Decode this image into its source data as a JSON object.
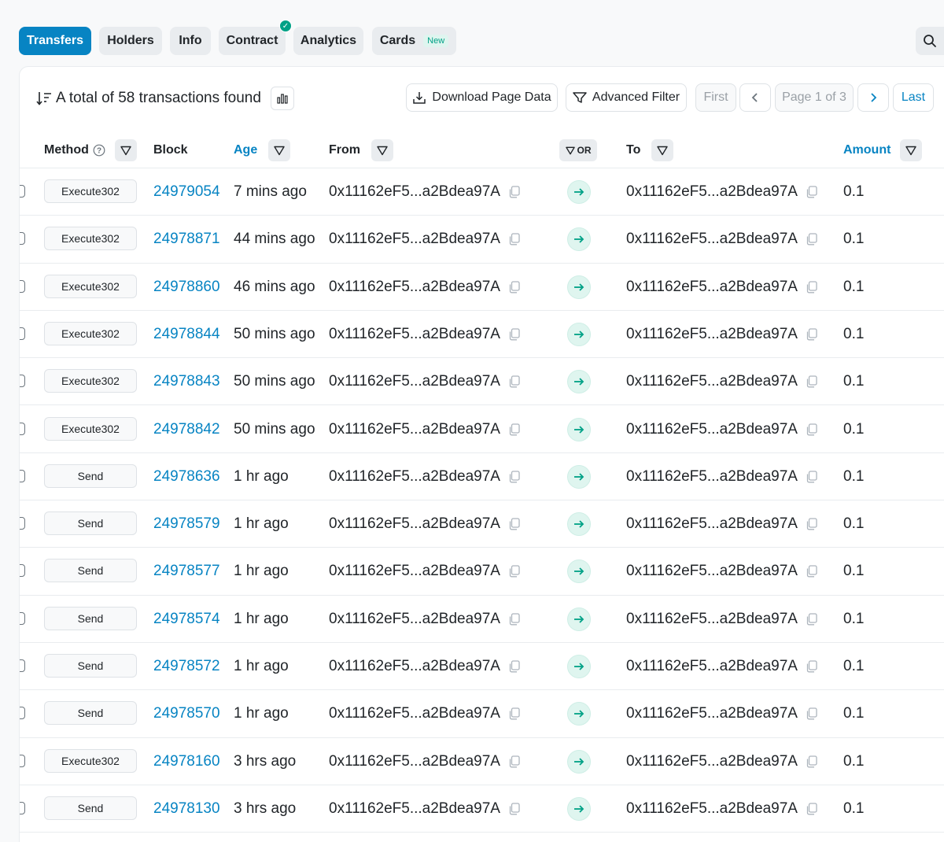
{
  "tabs": [
    {
      "label": "Transfers",
      "active": true
    },
    {
      "label": "Holders"
    },
    {
      "label": "Info"
    },
    {
      "label": "Contract",
      "verified": true
    },
    {
      "label": "Analytics"
    },
    {
      "label": "Cards",
      "badge": "New"
    }
  ],
  "toolbar": {
    "summary": "A total of 58 transactions found",
    "download_label": "Download Page Data",
    "filter_label": "Advanced Filter",
    "first_label": "First",
    "page_label": "Page 1 of 3",
    "last_label": "Last"
  },
  "table": {
    "headers": {
      "method": "Method",
      "block": "Block",
      "age": "Age",
      "from": "From",
      "or": "OR",
      "to": "To",
      "amount": "Amount"
    },
    "rows": [
      {
        "method": "Execute302",
        "block": "24979054",
        "age": "7 mins ago",
        "from": "0x11162eF5...a2Bdea97A",
        "to": "0x11162eF5...a2Bdea97A",
        "amount": "0.1"
      },
      {
        "method": "Execute302",
        "block": "24978871",
        "age": "44 mins ago",
        "from": "0x11162eF5...a2Bdea97A",
        "to": "0x11162eF5...a2Bdea97A",
        "amount": "0.1"
      },
      {
        "method": "Execute302",
        "block": "24978860",
        "age": "46 mins ago",
        "from": "0x11162eF5...a2Bdea97A",
        "to": "0x11162eF5...a2Bdea97A",
        "amount": "0.1"
      },
      {
        "method": "Execute302",
        "block": "24978844",
        "age": "50 mins ago",
        "from": "0x11162eF5...a2Bdea97A",
        "to": "0x11162eF5...a2Bdea97A",
        "amount": "0.1"
      },
      {
        "method": "Execute302",
        "block": "24978843",
        "age": "50 mins ago",
        "from": "0x11162eF5...a2Bdea97A",
        "to": "0x11162eF5...a2Bdea97A",
        "amount": "0.1"
      },
      {
        "method": "Execute302",
        "block": "24978842",
        "age": "50 mins ago",
        "from": "0x11162eF5...a2Bdea97A",
        "to": "0x11162eF5...a2Bdea97A",
        "amount": "0.1"
      },
      {
        "method": "Send",
        "block": "24978636",
        "age": "1 hr ago",
        "from": "0x11162eF5...a2Bdea97A",
        "to": "0x11162eF5...a2Bdea97A",
        "amount": "0.1"
      },
      {
        "method": "Send",
        "block": "24978579",
        "age": "1 hr ago",
        "from": "0x11162eF5...a2Bdea97A",
        "to": "0x11162eF5...a2Bdea97A",
        "amount": "0.1"
      },
      {
        "method": "Send",
        "block": "24978577",
        "age": "1 hr ago",
        "from": "0x11162eF5...a2Bdea97A",
        "to": "0x11162eF5...a2Bdea97A",
        "amount": "0.1"
      },
      {
        "method": "Send",
        "block": "24978574",
        "age": "1 hr ago",
        "from": "0x11162eF5...a2Bdea97A",
        "to": "0x11162eF5...a2Bdea97A",
        "amount": "0.1"
      },
      {
        "method": "Send",
        "block": "24978572",
        "age": "1 hr ago",
        "from": "0x11162eF5...a2Bdea97A",
        "to": "0x11162eF5...a2Bdea97A",
        "amount": "0.1"
      },
      {
        "method": "Send",
        "block": "24978570",
        "age": "1 hr ago",
        "from": "0x11162eF5...a2Bdea97A",
        "to": "0x11162eF5...a2Bdea97A",
        "amount": "0.1"
      },
      {
        "method": "Execute302",
        "block": "24978160",
        "age": "3 hrs ago",
        "from": "0x11162eF5...a2Bdea97A",
        "to": "0x11162eF5...a2Bdea97A",
        "amount": "0.1"
      },
      {
        "method": "Send",
        "block": "24978130",
        "age": "3 hrs ago",
        "from": "0x11162eF5...a2Bdea97A",
        "to": "0x11162eF5...a2Bdea97A",
        "amount": "0.1"
      }
    ]
  },
  "colors": {
    "accent": "#0784c3",
    "success": "#00a186",
    "border": "#e9ecef"
  }
}
